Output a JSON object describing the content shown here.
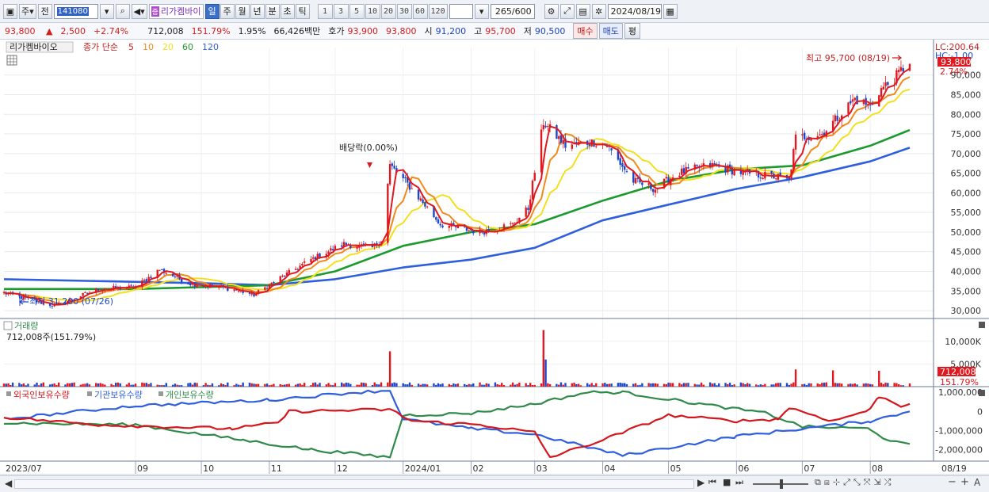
{
  "toolbar": {
    "period_prefix": "주",
    "prev_label": "전",
    "code": "141080",
    "stock_badge": "증",
    "stock_name": "리가켐바이",
    "period_tabs": [
      "일",
      "주",
      "월",
      "년",
      "분",
      "초",
      "틱"
    ],
    "active_tab": "일",
    "interval_buttons": [
      "1",
      "3",
      "5",
      "10",
      "20",
      "30",
      "60",
      "120"
    ],
    "count_value": "265",
    "count_total": "/600",
    "date": "2024/08/19"
  },
  "quote": {
    "price": "93,800",
    "change": "2,500",
    "change_pct": "+2.74%",
    "volume": "712,008",
    "volume_ratio": "151.79%",
    "turnover_pct": "1.95%",
    "amount": "66,426백만",
    "ask_label": "호가",
    "ask": "93,900",
    "bid": "93,800",
    "open_label": "시",
    "open": "91,200",
    "high_label": "고",
    "high": "95,700",
    "low_label": "저",
    "low": "90,500",
    "buy_label": "매수",
    "sell_label": "매도",
    "eval_label": "평"
  },
  "price_panel": {
    "legend_name": "리가켐바이오",
    "legend_kind": "종가 단순",
    "ma_periods": [
      "5",
      "10",
      "20",
      "60",
      "120"
    ],
    "lc_label": "LC:200.64",
    "hc_label": "HC:-1.00",
    "last_price_tag": "93,800",
    "last_pct_tag": "2.74%",
    "high_annotation": "최고 95,700 (08/19)",
    "low_annotation": "최저 31,200 (07/26)",
    "dividend_annotation": "배당락(0.00%)",
    "y_ticks": [
      "90,000",
      "85,000",
      "80,000",
      "75,000",
      "70,000",
      "65,000",
      "60,000",
      "55,000",
      "50,000",
      "45,000",
      "40,000",
      "35,000",
      "30,000"
    ]
  },
  "volume_panel": {
    "title": "거래량",
    "subtitle": "712,008주(151.79%)",
    "y_ticks": [
      "10,000K",
      "5,000K"
    ],
    "last_tag": "712,008",
    "last_pct_tag": "151.79%"
  },
  "holdings_panel": {
    "legend": [
      "외국인보유수량",
      "기관보유수량",
      "개인보유수량"
    ],
    "y_ticks": [
      "1,000,000",
      "0",
      "-1,000,000",
      "-2,000,000"
    ]
  },
  "x_axis": [
    "2023/07",
    "09",
    "10",
    "11",
    "12",
    "2024/01",
    "02",
    "03",
    "04",
    "05",
    "06",
    "07",
    "08",
    "08/19"
  ],
  "colors": {
    "up": "#e0181f",
    "down": "#1c47c9",
    "ma5": "#e0181f",
    "ma10": "#f08a1c",
    "ma20": "#f2e01f",
    "ma60": "#1c9a2e",
    "ma120": "#2f5fdc",
    "foreign": "#d4161d",
    "institution": "#2f5fdc",
    "individual": "#2f8a4a"
  },
  "chart_data": {
    "type": "candlestick",
    "date_range": [
      "2023/07/03",
      "2024/08/19"
    ],
    "price_ylim": [
      28000,
      97000
    ],
    "price_path": [
      [
        "2023/07/03",
        34500
      ],
      [
        "2023/07/26",
        31200
      ],
      [
        "2023/08/15",
        35500
      ],
      [
        "2023/09/01",
        36000
      ],
      [
        "2023/09/12",
        40500
      ],
      [
        "2023/09/25",
        37000
      ],
      [
        "2023/10/15",
        35500
      ],
      [
        "2023/10/25",
        34000
      ],
      [
        "2023/11/05",
        38000
      ],
      [
        "2023/11/20",
        43000
      ],
      [
        "2023/12/05",
        47000
      ],
      [
        "2023/12/18",
        46000
      ],
      [
        "2023/12/22",
        48000
      ],
      [
        "2023/12/26",
        67000
      ],
      [
        "2024/01/05",
        61000
      ],
      [
        "2024/01/18",
        52000
      ],
      [
        "2024/02/05",
        50000
      ],
      [
        "2024/02/20",
        52000
      ],
      [
        "2024/02/27",
        56000
      ],
      [
        "2024/03/05",
        78000
      ],
      [
        "2024/03/15",
        72000
      ],
      [
        "2024/03/28",
        73000
      ],
      [
        "2024/04/03",
        72000
      ],
      [
        "2024/04/15",
        63000
      ],
      [
        "2024/04/25",
        61000
      ],
      [
        "2024/05/05",
        65000
      ],
      [
        "2024/05/20",
        67000
      ],
      [
        "2024/06/05",
        65000
      ],
      [
        "2024/06/20",
        64000
      ],
      [
        "2024/06/25",
        63000
      ],
      [
        "2024/06/28",
        74000
      ],
      [
        "2024/07/10",
        75000
      ],
      [
        "2024/07/25",
        84000
      ],
      [
        "2024/08/01",
        82000
      ],
      [
        "2024/08/05",
        86000
      ],
      [
        "2024/08/12",
        89000
      ],
      [
        "2024/08/19",
        93800
      ]
    ],
    "ma60_path": [
      [
        "2023/07/03",
        35500
      ],
      [
        "2023/09/01",
        35500
      ],
      [
        "2023/11/01",
        36500
      ],
      [
        "2023/12/01",
        40000
      ],
      [
        "2024/01/01",
        46500
      ],
      [
        "2024/02/01",
        50000
      ],
      [
        "2024/03/01",
        52000
      ],
      [
        "2024/04/01",
        58000
      ],
      [
        "2024/05/01",
        63000
      ],
      [
        "2024/06/01",
        66000
      ],
      [
        "2024/07/01",
        67000
      ],
      [
        "2024/08/01",
        72000
      ],
      [
        "2024/08/19",
        76000
      ]
    ],
    "ma120_path": [
      [
        "2023/07/03",
        38000
      ],
      [
        "2023/10/01",
        37000
      ],
      [
        "2023/11/01",
        36500
      ],
      [
        "2023/12/01",
        38000
      ],
      [
        "2024/01/01",
        41000
      ],
      [
        "2024/02/01",
        43000
      ],
      [
        "2024/03/01",
        46000
      ],
      [
        "2024/04/01",
        53000
      ],
      [
        "2024/05/01",
        57000
      ],
      [
        "2024/06/01",
        61000
      ],
      [
        "2024/07/01",
        64000
      ],
      [
        "2024/08/01",
        68000
      ],
      [
        "2024/08/19",
        71500
      ]
    ],
    "volume_ylim": [
      0,
      14000
    ],
    "volume_spikes_k": [
      [
        "2023/12/26",
        7800
      ],
      [
        "2024/03/05",
        12500
      ],
      [
        "2024/03/06",
        6000
      ],
      [
        "2024/06/28",
        3800
      ],
      [
        "2024/07/15",
        3600
      ],
      [
        "2024/08/05",
        3500
      ],
      [
        "2024/08/19",
        712
      ]
    ],
    "holdings_ylim": [
      -2600000,
      1300000
    ],
    "foreign_path": [
      [
        "2023/07/03",
        -300000
      ],
      [
        "2023/08/15",
        -700000
      ],
      [
        "2023/10/15",
        -900000
      ],
      [
        "2023/11/05",
        -600000
      ],
      [
        "2023/11/10",
        0
      ],
      [
        "2023/12/26",
        100000
      ],
      [
        "2024/01/05",
        -500000
      ],
      [
        "2024/02/05",
        -700000
      ],
      [
        "2024/03/01",
        -1100000
      ],
      [
        "2024/03/08",
        -2400000
      ],
      [
        "2024/04/01",
        -1500000
      ],
      [
        "2024/05/01",
        -200000
      ],
      [
        "2024/06/01",
        -500000
      ],
      [
        "2024/06/20",
        -400000
      ],
      [
        "2024/06/25",
        200000
      ],
      [
        "2024/07/15",
        -500000
      ],
      [
        "2024/08/01",
        100000
      ],
      [
        "2024/08/05",
        800000
      ],
      [
        "2024/08/15",
        300000
      ],
      [
        "2024/08/19",
        400000
      ]
    ],
    "institution_path": [
      [
        "2023/07/03",
        -400000
      ],
      [
        "2023/09/01",
        300000
      ],
      [
        "2023/11/01",
        600000
      ],
      [
        "2023/12/10",
        1000000
      ],
      [
        "2023/12/26",
        1100000
      ],
      [
        "2024/01/01",
        -400000
      ],
      [
        "2024/02/01",
        -900000
      ],
      [
        "2024/03/01",
        -1200000
      ],
      [
        "2024/04/10",
        -2300000
      ],
      [
        "2024/06/01",
        -1300000
      ],
      [
        "2024/07/01",
        -900000
      ],
      [
        "2024/08/01",
        -500000
      ],
      [
        "2024/08/19",
        0
      ]
    ],
    "individual_path": [
      [
        "2023/07/03",
        -600000
      ],
      [
        "2023/09/01",
        -700000
      ],
      [
        "2023/10/20",
        -1500000
      ],
      [
        "2023/11/20",
        -2000000
      ],
      [
        "2023/12/26",
        -2400000
      ],
      [
        "2024/01/01",
        -200000
      ],
      [
        "2024/02/01",
        -100000
      ],
      [
        "2024/03/01",
        400000
      ],
      [
        "2024/03/25",
        1000000
      ],
      [
        "2024/04/10",
        1000000
      ],
      [
        "2024/05/15",
        400000
      ],
      [
        "2024/06/15",
        -100000
      ],
      [
        "2024/07/01",
        -800000
      ],
      [
        "2024/08/01",
        -900000
      ],
      [
        "2024/08/10",
        -1600000
      ],
      [
        "2024/08/19",
        -1700000
      ]
    ]
  }
}
